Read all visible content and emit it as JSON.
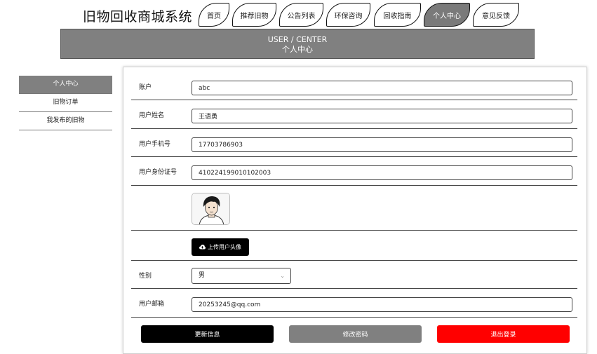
{
  "site_title": "旧物回收商城系统",
  "nav": {
    "tabs": [
      {
        "label": "首页"
      },
      {
        "label": "推荐旧物"
      },
      {
        "label": "公告列表"
      },
      {
        "label": "环保咨询"
      },
      {
        "label": "回收指南"
      },
      {
        "label": "个人中心",
        "active": true
      },
      {
        "label": "意见反馈"
      }
    ]
  },
  "banner": {
    "en": "USER / CENTER",
    "cn": "个人中心"
  },
  "sidebar": {
    "items": [
      {
        "label": "个人中心",
        "active": true
      },
      {
        "label": "旧物订单"
      },
      {
        "label": "我发布的旧物"
      }
    ]
  },
  "form": {
    "account": {
      "label": "账户",
      "value": "abc"
    },
    "name": {
      "label": "用户姓名",
      "value": "王语勇"
    },
    "phone": {
      "label": "用户手机号",
      "value": "17703786903"
    },
    "id_card": {
      "label": "用户身份证号",
      "value": "410224199010102003"
    },
    "upload_label": "上传用户头像",
    "gender": {
      "label": "性别",
      "value": "男"
    },
    "email": {
      "label": "用户邮箱",
      "value": "20253245@qq.com"
    }
  },
  "actions": {
    "update": "更新信息",
    "change_password": "修改密码",
    "logout": "退出登录"
  },
  "colors": {
    "primary_dark": "#000000",
    "secondary_gray": "#808080",
    "danger_red": "#ff0000"
  }
}
